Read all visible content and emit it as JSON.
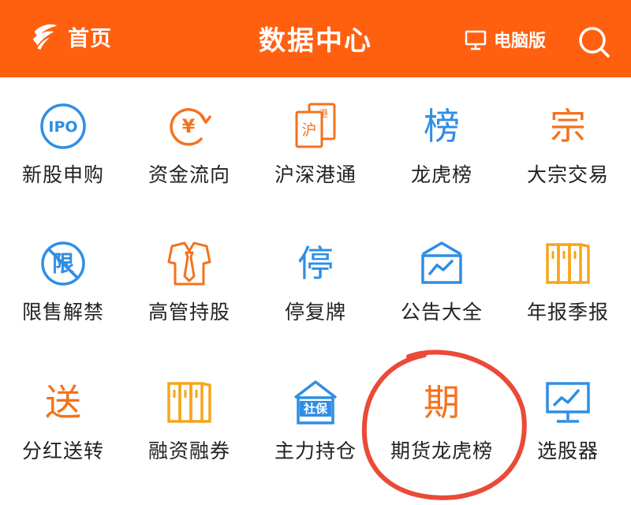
{
  "header": {
    "home_label": "首页",
    "title": "数据中心",
    "desktop_label": "电脑版",
    "bg_color": "#ff6010"
  },
  "grid": {
    "accent_blue": "#2f8ee4",
    "accent_orange": "#f4721c",
    "accent_yellow": "#f6a51b",
    "items": [
      {
        "label": "新股申购",
        "icon": "ipo-icon",
        "icon_text": "IPO"
      },
      {
        "label": "资金流向",
        "icon": "yuan-cycle-icon",
        "icon_text": "¥"
      },
      {
        "label": "沪深港通",
        "icon": "hk-connect-icon",
        "icon_text": "沪"
      },
      {
        "label": "龙虎榜",
        "icon": "bang-icon",
        "icon_text": "榜"
      },
      {
        "label": "大宗交易",
        "icon": "zong-icon",
        "icon_text": "宗"
      },
      {
        "label": "限售解禁",
        "icon": "restricted-icon",
        "icon_text": "限"
      },
      {
        "label": "高管持股",
        "icon": "executive-tie-icon"
      },
      {
        "label": "停复牌",
        "icon": "ting-icon",
        "icon_text": "停"
      },
      {
        "label": "公告大全",
        "icon": "announcement-chart-icon"
      },
      {
        "label": "年报季报",
        "icon": "binders-icon"
      },
      {
        "label": "分红送转",
        "icon": "song-icon",
        "icon_text": "送"
      },
      {
        "label": "融资融券",
        "icon": "binders-icon"
      },
      {
        "label": "主力持仓",
        "icon": "social-security-house-icon",
        "icon_text": "社保"
      },
      {
        "label": "期货龙虎榜",
        "icon": "qi-icon",
        "icon_text": "期"
      },
      {
        "label": "选股器",
        "icon": "monitor-chart-icon"
      }
    ]
  },
  "annotation": {
    "color": "#ea4a37"
  }
}
